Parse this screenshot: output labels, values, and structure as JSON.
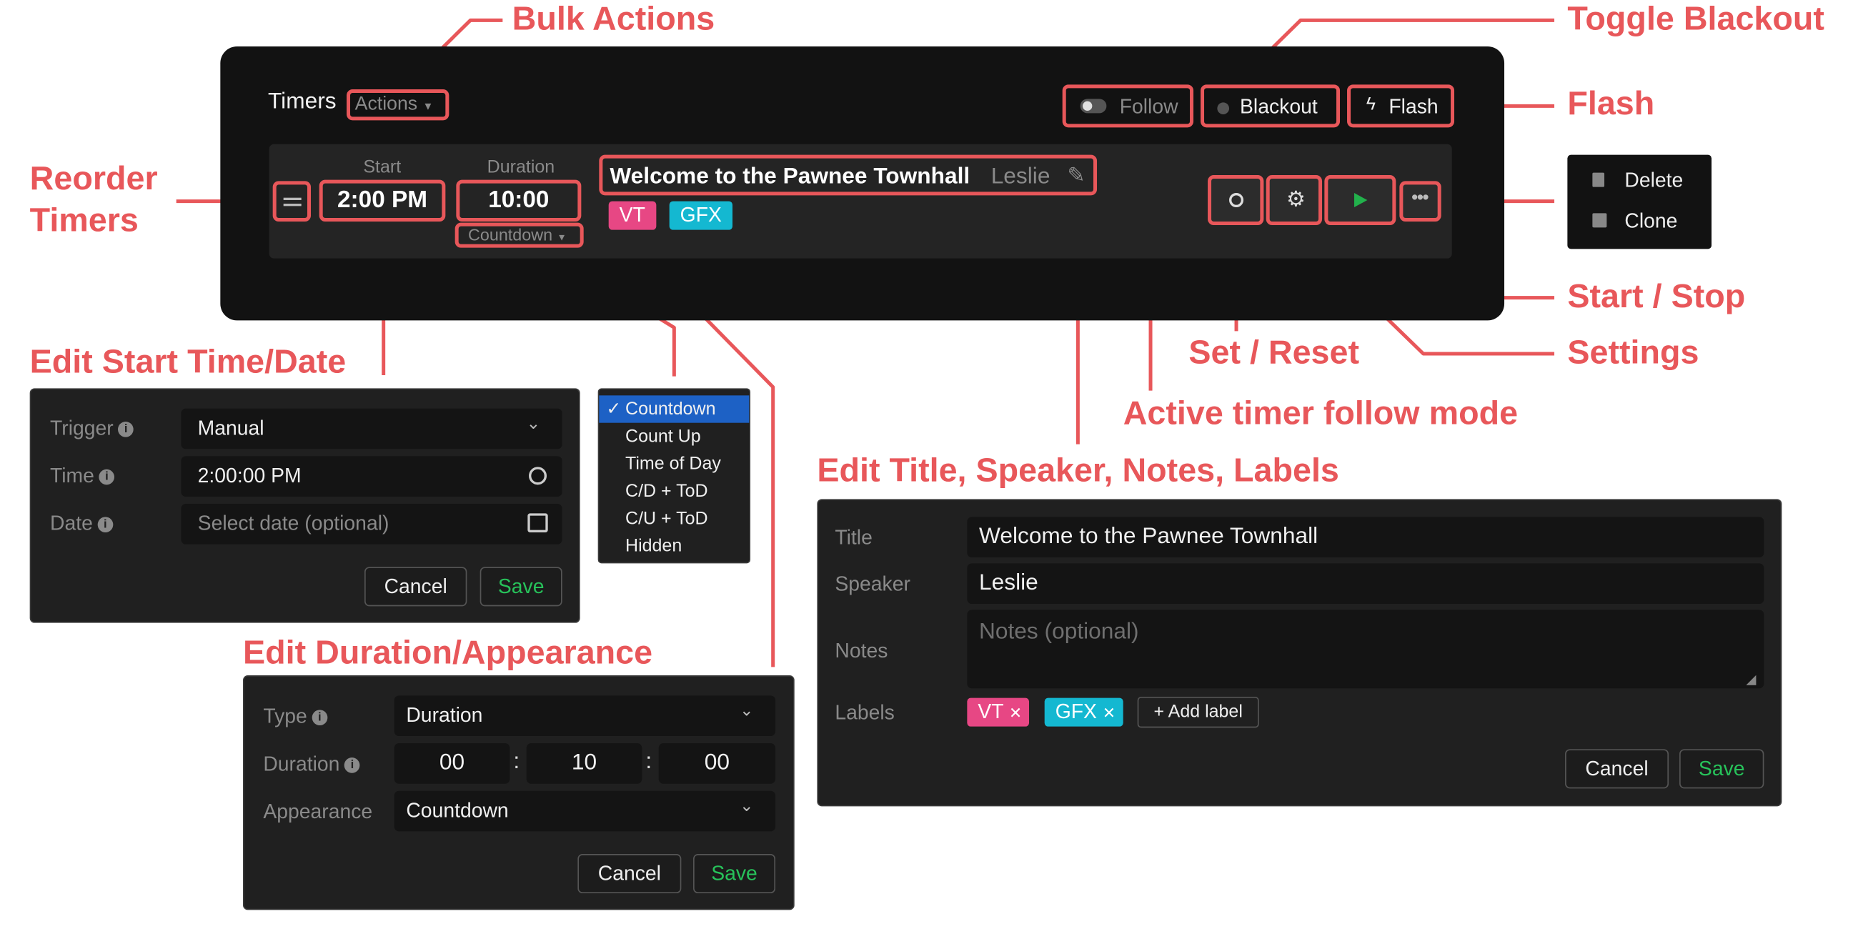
{
  "annotations": {
    "bulk_actions": "Bulk Actions",
    "toggle_blackout": "Toggle Blackout",
    "flash": "Flash",
    "reorder_1": "Reorder",
    "reorder_2": "Timers",
    "start_stop": "Start / Stop",
    "set_reset": "Set / Reset",
    "settings": "Settings",
    "follow_mode": "Active timer follow mode",
    "edit_start": "Edit Start Time/Date",
    "edit_title": "Edit Title, Speaker, Notes, Labels",
    "edit_duration": "Edit Duration/Appearance"
  },
  "header": {
    "title": "Timers",
    "actions_label": "Actions",
    "follow_label": "Follow",
    "blackout_label": "Blackout",
    "flash_label": "Flash"
  },
  "timer": {
    "start_heading": "Start",
    "duration_heading": "Duration",
    "start_value": "2:00 PM",
    "duration_value": "10:00",
    "appearance": "Countdown",
    "title": "Welcome to the Pawnee Townhall",
    "speaker": "Leslie",
    "labels": [
      {
        "name": "VT",
        "color": "#e74784"
      },
      {
        "name": "GFX",
        "color": "#14b8d1"
      }
    ]
  },
  "more_menu": {
    "items": [
      "Delete",
      "Clone"
    ]
  },
  "start_dialog": {
    "trigger_label": "Trigger",
    "trigger_value": "Manual",
    "time_label": "Time",
    "time_value": "2:00:00 PM",
    "date_label": "Date",
    "date_placeholder": "Select date (optional)",
    "cancel": "Cancel",
    "save": "Save"
  },
  "appearance_menu": {
    "selected": "Countdown",
    "items": [
      "Countdown",
      "Count Up",
      "Time of Day",
      "C/D + ToD",
      "C/U + ToD",
      "Hidden"
    ]
  },
  "duration_dialog": {
    "type_label": "Type",
    "type_value": "Duration",
    "duration_label": "Duration",
    "hours": "00",
    "minutes": "10",
    "seconds": "00",
    "separator": ":",
    "appearance_label": "Appearance",
    "appearance_value": "Countdown",
    "cancel": "Cancel",
    "save": "Save"
  },
  "title_dialog": {
    "title_label": "Title",
    "title_value": "Welcome to the Pawnee Townhall",
    "speaker_label": "Speaker",
    "speaker_value": "Leslie",
    "notes_label": "Notes",
    "notes_placeholder": "Notes (optional)",
    "labels_label": "Labels",
    "labels": [
      "VT",
      "GFX"
    ],
    "add_label": "Add label",
    "cancel": "Cancel",
    "save": "Save"
  },
  "colors": {
    "accent": "#e8575a",
    "save_green": "#27c25a",
    "play_green": "#22b14c",
    "select_blue": "#1d61c5"
  }
}
